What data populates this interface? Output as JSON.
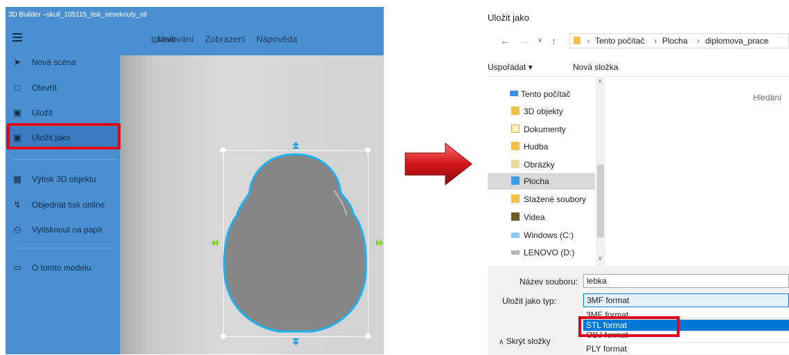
{
  "colors": {
    "app_blue": "#4a8fd0",
    "highlight_red": "#e0001b",
    "selection_blue": "#0078d7",
    "dialog_selection": "#cce8ff",
    "skull_outline": "#1fb0f0",
    "skull_fill": "#868686"
  },
  "builder": {
    "window_title": "3D Builder –skull_105115_tisk_seseknuty_stl",
    "menu": {
      "hamburger_icon": "hamburger-icon",
      "items": [
        "Upravit",
        "Malování",
        "Zobrazení",
        "Nápověda"
      ],
      "first_visible": "Ipravit"
    },
    "sidebar": [
      {
        "label": "Nová scéna",
        "icon": "new-scene-icon"
      },
      {
        "label": "Otevřít",
        "icon": "open-icon"
      },
      {
        "label": "Uložit",
        "icon": "save-icon"
      },
      {
        "label": "Uložit jako",
        "icon": "save-as-icon",
        "selected": true
      },
      {
        "label": "Výtisk 3D objektu",
        "icon": "print-3d-icon"
      },
      {
        "label": "Objednat tisk online",
        "icon": "cart-icon"
      },
      {
        "label": "Vytisknout na papír",
        "icon": "printer-icon"
      },
      {
        "label": "O tomto modelu",
        "icon": "model-info-icon"
      }
    ]
  },
  "dialog": {
    "title": "Uložit jako",
    "nav": {
      "back_icon": "back-arrow-icon",
      "forward_icon": "forward-arrow-icon",
      "history_icon": "chevron-down-icon",
      "up_icon": "up-arrow-icon"
    },
    "breadcrumb": [
      "Tento počítač",
      "Plocha",
      "diplomova_prace"
    ],
    "toolbar": {
      "organize": "Uspořádat ▾",
      "new_folder": "Nová složka"
    },
    "search_hint": "Hledání",
    "tree": [
      {
        "label": "Tento počítač",
        "icon": "computer-icon",
        "level": 0
      },
      {
        "label": "3D objekty",
        "icon": "folder-3d-icon",
        "level": 1
      },
      {
        "label": "Dokumenty",
        "icon": "documents-icon",
        "level": 1
      },
      {
        "label": "Hudba",
        "icon": "music-icon",
        "level": 1
      },
      {
        "label": "Obrázky",
        "icon": "pictures-icon",
        "level": 1
      },
      {
        "label": "Plocha",
        "icon": "desktop-folder-icon",
        "level": 1,
        "selected": true
      },
      {
        "label": "Stažené soubory",
        "icon": "downloads-icon",
        "level": 1
      },
      {
        "label": "Videa",
        "icon": "videos-icon",
        "level": 1
      },
      {
        "label": "Windows (C:)",
        "icon": "drive-icon",
        "level": 1
      },
      {
        "label": "LENOVO (D:)",
        "icon": "drive-icon",
        "level": 1
      }
    ],
    "filename_label": "Název souboru:",
    "filename_value": "lebka",
    "filetype_label": "Uložit jako typ:",
    "filetype_value": "3MF format",
    "filetype_options": [
      "3MF format",
      "STL format",
      "OBJ format",
      "PLY format"
    ],
    "filetype_highlighted": "STL format",
    "hide_folders": "Skrýt složky"
  }
}
